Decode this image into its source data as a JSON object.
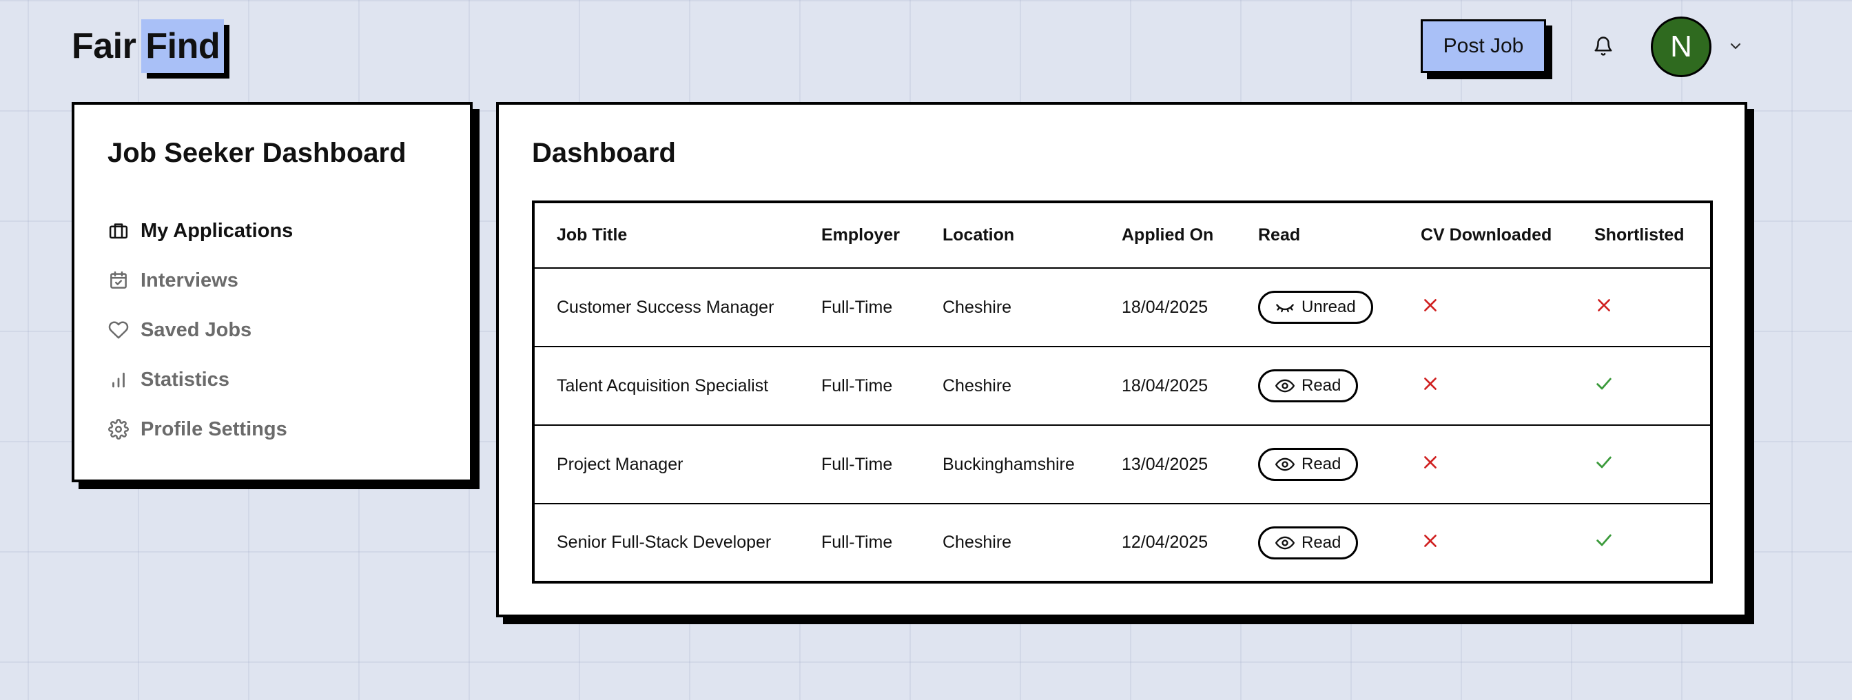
{
  "header": {
    "logo_part1": "Fair",
    "logo_part2": "Find",
    "post_job_label": "Post Job",
    "avatar_initial": "N",
    "brand_color": "#a9c0f7",
    "avatar_color": "#2f6a1f"
  },
  "sidebar": {
    "title": "Job Seeker Dashboard",
    "items": [
      {
        "label": "My Applications",
        "icon": "briefcase-icon",
        "active": true
      },
      {
        "label": "Interviews",
        "icon": "calendar-check-icon",
        "active": false
      },
      {
        "label": "Saved Jobs",
        "icon": "heart-icon",
        "active": false
      },
      {
        "label": "Statistics",
        "icon": "bar-chart-icon",
        "active": false
      },
      {
        "label": "Profile Settings",
        "icon": "gear-icon",
        "active": false
      }
    ]
  },
  "main": {
    "title": "Dashboard",
    "table": {
      "headers": [
        "Job Title",
        "Employer",
        "Location",
        "Applied On",
        "Read",
        "CV Downloaded",
        "Shortlisted"
      ],
      "rows": [
        {
          "job_title": "Customer Success Manager",
          "employer": "Full-Time",
          "location": "Cheshire",
          "applied_on": "18/04/2025",
          "read": "Unread",
          "read_icon": "eye-closed-icon",
          "cv_downloaded": false,
          "shortlisted": false
        },
        {
          "job_title": "Talent Acquisition Specialist",
          "employer": "Full-Time",
          "location": "Cheshire",
          "applied_on": "18/04/2025",
          "read": "Read",
          "read_icon": "eye-icon",
          "cv_downloaded": false,
          "shortlisted": true
        },
        {
          "job_title": "Project Manager",
          "employer": "Full-Time",
          "location": "Buckinghamshire",
          "applied_on": "13/04/2025",
          "read": "Read",
          "read_icon": "eye-icon",
          "cv_downloaded": false,
          "shortlisted": true
        },
        {
          "job_title": "Senior Full-Stack Developer",
          "employer": "Full-Time",
          "location": "Cheshire",
          "applied_on": "12/04/2025",
          "read": "Read",
          "read_icon": "eye-icon",
          "cv_downloaded": false,
          "shortlisted": true
        }
      ]
    },
    "status_colors": {
      "no": "#d02020",
      "yes": "#3a9a3a"
    }
  }
}
